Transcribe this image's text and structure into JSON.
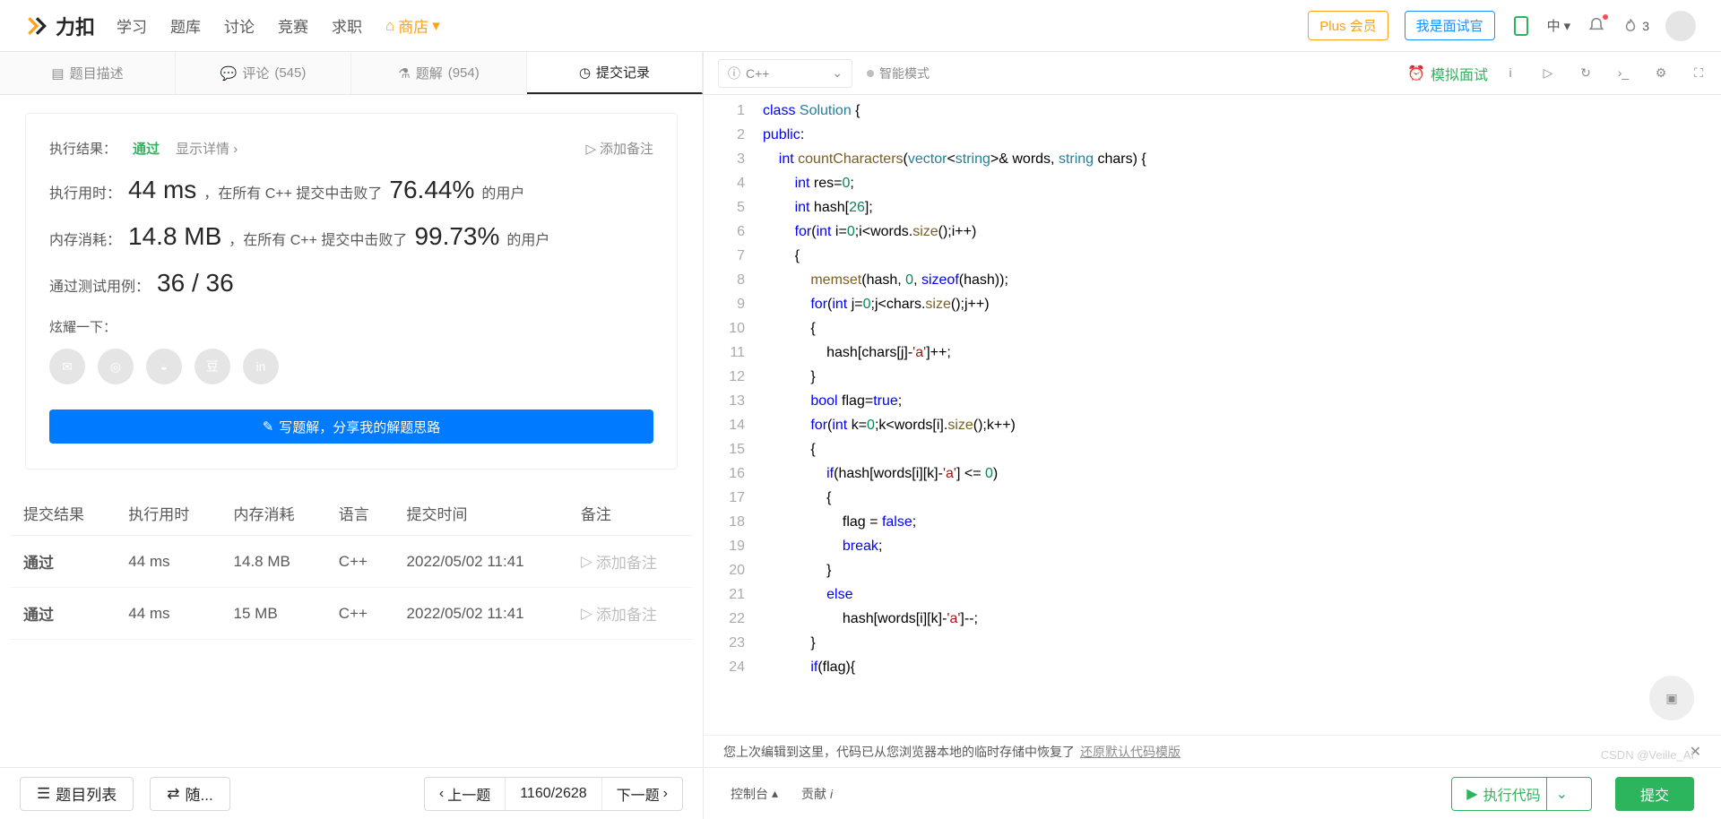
{
  "nav": {
    "brand": "力扣",
    "links": [
      "学习",
      "题库",
      "讨论",
      "竞赛",
      "求职"
    ],
    "shop": "商店",
    "plus": "Plus 会员",
    "interviewer": "我是面试官",
    "lang": "中",
    "streak": "3"
  },
  "left_tabs": {
    "desc": "题目描述",
    "comments_label": "评论",
    "comments_count": "(545)",
    "solutions_label": "题解",
    "solutions_count": "(954)",
    "submissions": "提交记录"
  },
  "result": {
    "exec_result_label": "执行结果：",
    "status": "通过",
    "show_detail": "显示详情",
    "add_note": "添加备注",
    "runtime_label": "执行用时：",
    "runtime_value": "44 ms",
    "runtime_text1": "，在所有 C++ 提交中击败了",
    "runtime_pct": "76.44%",
    "runtime_text2": "的用户",
    "memory_label": "内存消耗：",
    "memory_value": "14.8 MB",
    "memory_text1": "，在所有 C++ 提交中击败了",
    "memory_pct": "99.73%",
    "memory_text2": "的用户",
    "testcases_label": "通过测试用例：",
    "testcases_value": "36 / 36",
    "share_label": "炫耀一下：",
    "write_solution": "写题解，分享我的解题思路"
  },
  "table": {
    "headers": [
      "提交结果",
      "执行用时",
      "内存消耗",
      "语言",
      "提交时间",
      "备注"
    ],
    "rows": [
      {
        "status": "通过",
        "time": "44 ms",
        "mem": "14.8 MB",
        "lang": "C++",
        "submitted": "2022/05/02 11:41",
        "note": "添加备注"
      },
      {
        "status": "通过",
        "time": "44 ms",
        "mem": "15 MB",
        "lang": "C++",
        "submitted": "2022/05/02 11:41",
        "note": "添加备注"
      }
    ]
  },
  "editor": {
    "lang": "C++",
    "smart_mode": "智能模式",
    "mock": "模拟面试",
    "code_lines": [
      [
        [
          "kw",
          "class"
        ],
        [
          "op",
          " "
        ],
        [
          "typ",
          "Solution"
        ],
        [
          "op",
          " {"
        ]
      ],
      [
        [
          "kw",
          "public"
        ],
        [
          "op",
          ":"
        ]
      ],
      [
        [
          "op",
          "    "
        ],
        [
          "kw",
          "int"
        ],
        [
          "op",
          " "
        ],
        [
          "fn",
          "countCharacters"
        ],
        [
          "op",
          "("
        ],
        [
          "typ",
          "vector"
        ],
        [
          "op",
          "<"
        ],
        [
          "typ",
          "string"
        ],
        [
          "op",
          ">& words, "
        ],
        [
          "typ",
          "string"
        ],
        [
          "op",
          " chars) {"
        ]
      ],
      [
        [
          "op",
          "        "
        ],
        [
          "kw",
          "int"
        ],
        [
          "op",
          " res="
        ],
        [
          "num",
          "0"
        ],
        [
          "op",
          ";"
        ]
      ],
      [
        [
          "op",
          "        "
        ],
        [
          "kw",
          "int"
        ],
        [
          "op",
          " hash["
        ],
        [
          "num",
          "26"
        ],
        [
          "op",
          "];"
        ]
      ],
      [
        [
          "op",
          "        "
        ],
        [
          "kw",
          "for"
        ],
        [
          "op",
          "("
        ],
        [
          "kw",
          "int"
        ],
        [
          "op",
          " i="
        ],
        [
          "num",
          "0"
        ],
        [
          "op",
          ";i<words."
        ],
        [
          "fn",
          "size"
        ],
        [
          "op",
          "();i++)"
        ]
      ],
      [
        [
          "op",
          "        {"
        ]
      ],
      [
        [
          "op",
          "            "
        ],
        [
          "fn",
          "memset"
        ],
        [
          "op",
          "(hash, "
        ],
        [
          "num",
          "0"
        ],
        [
          "op",
          ", "
        ],
        [
          "kw",
          "sizeof"
        ],
        [
          "op",
          "(hash));"
        ]
      ],
      [
        [
          "op",
          "            "
        ],
        [
          "kw",
          "for"
        ],
        [
          "op",
          "("
        ],
        [
          "kw",
          "int"
        ],
        [
          "op",
          " j="
        ],
        [
          "num",
          "0"
        ],
        [
          "op",
          ";j<chars."
        ],
        [
          "fn",
          "size"
        ],
        [
          "op",
          "();j++)"
        ]
      ],
      [
        [
          "op",
          "            {"
        ]
      ],
      [
        [
          "op",
          "                hash[chars[j]-"
        ],
        [
          "str",
          "'a'"
        ],
        [
          "op",
          "]++;"
        ]
      ],
      [
        [
          "op",
          "            }"
        ]
      ],
      [
        [
          "op",
          "            "
        ],
        [
          "kw",
          "bool"
        ],
        [
          "op",
          " flag="
        ],
        [
          "kw",
          "true"
        ],
        [
          "op",
          ";"
        ]
      ],
      [
        [
          "op",
          "            "
        ],
        [
          "kw",
          "for"
        ],
        [
          "op",
          "("
        ],
        [
          "kw",
          "int"
        ],
        [
          "op",
          " k="
        ],
        [
          "num",
          "0"
        ],
        [
          "op",
          ";k<words[i]."
        ],
        [
          "fn",
          "size"
        ],
        [
          "op",
          "();k++)"
        ]
      ],
      [
        [
          "op",
          "            {"
        ]
      ],
      [
        [
          "op",
          "                "
        ],
        [
          "kw",
          "if"
        ],
        [
          "op",
          "(hash[words[i][k]-"
        ],
        [
          "str",
          "'a'"
        ],
        [
          "op",
          "] <= "
        ],
        [
          "num",
          "0"
        ],
        [
          "op",
          ")"
        ]
      ],
      [
        [
          "op",
          "                {"
        ]
      ],
      [
        [
          "op",
          "                    flag = "
        ],
        [
          "kw",
          "false"
        ],
        [
          "op",
          ";"
        ]
      ],
      [
        [
          "op",
          "                    "
        ],
        [
          "kw",
          "break"
        ],
        [
          "op",
          ";"
        ]
      ],
      [
        [
          "op",
          "                }"
        ]
      ],
      [
        [
          "op",
          "                "
        ],
        [
          "kw",
          "else"
        ]
      ],
      [
        [
          "op",
          "                    hash[words[i][k]-"
        ],
        [
          "str",
          "'a'"
        ],
        [
          "op",
          "]--;"
        ]
      ],
      [
        [
          "op",
          "            }"
        ]
      ],
      [
        [
          "op",
          "            "
        ],
        [
          "kw",
          "if"
        ],
        [
          "op",
          "(flag){"
        ]
      ]
    ],
    "restore_msg": "您上次编辑到这里，代码已从您浏览器本地的临时存储中恢复了",
    "restore_link": "还原默认代码模版"
  },
  "bottom": {
    "list": "题目列表",
    "random": "随...",
    "prev": "上一题",
    "counter": "1160/2628",
    "next": "下一题",
    "console": "控制台",
    "contribute": "贡献",
    "run": "执行代码",
    "submit": "提交"
  },
  "watermark": "CSDN @Veille_AI"
}
